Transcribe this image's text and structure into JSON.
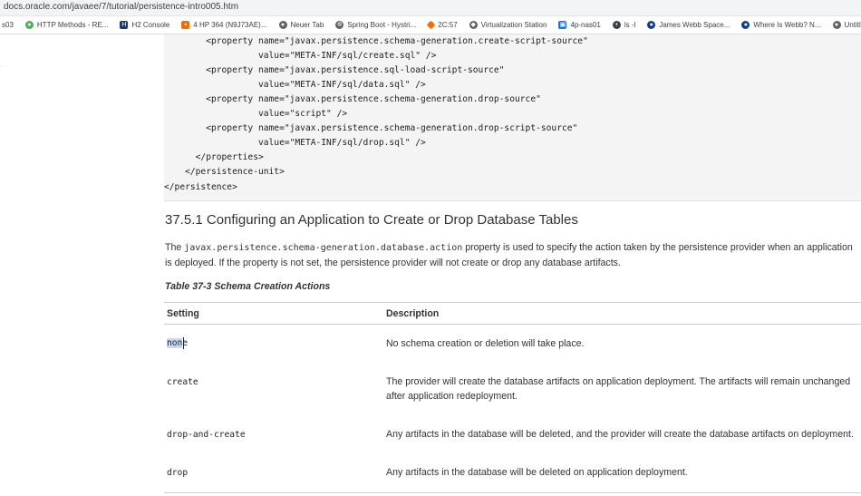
{
  "browser": {
    "url": "docs.oracle.com/javaee/7/tutorial/persistence-intro005.htm",
    "bookmarks": [
      {
        "label": "s03",
        "icon": "none",
        "color": "#ffffff"
      },
      {
        "label": "HTTP Methods - RE...",
        "icon": "globe-icon",
        "color": "#4caf50"
      },
      {
        "label": "H2 Console",
        "icon": "h2-icon",
        "color": "#1a3b6e"
      },
      {
        "label": "4 HP 364 (N9J73AE)...",
        "icon": "bookmark-icon",
        "color": "#e8710a"
      },
      {
        "label": "Neuer Tab",
        "icon": "globe-icon",
        "color": "#5f6368"
      },
      {
        "label": "Spring Boot - Hystri...",
        "icon": "gear-icon",
        "color": "#5f6368"
      },
      {
        "label": "2C:57",
        "icon": "diamond-icon",
        "color": "#e8710a"
      },
      {
        "label": "Virtualization Station",
        "icon": "vs-icon",
        "color": "#5f6368"
      },
      {
        "label": "4p-nas01",
        "icon": "nas-icon",
        "color": "#1a73e8"
      },
      {
        "label": "ls -l",
        "icon": "plus-icon",
        "color": "#5f6368"
      },
      {
        "label": "James Webb Space...",
        "icon": "nasa-icon",
        "color": "#0b3d91"
      },
      {
        "label": "Where Is Webb? N...",
        "icon": "nasa-icon",
        "color": "#0b3d91"
      },
      {
        "label": "Untitled",
        "icon": "globe-icon",
        "color": "#5f6368"
      }
    ]
  },
  "code": {
    "lines": [
      "        <property name=\"javax.persistence.schema-generation.create-script-source\"",
      "                  value=\"META-INF/sql/create.sql\" />",
      "        <property name=\"javax.persistence.sql-load-script-source\"",
      "                  value=\"META-INF/sql/data.sql\" />",
      "        <property name=\"javax.persistence.schema-generation.drop-source\"",
      "                  value=\"script\" />",
      "        <property name=\"javax.persistence.schema-generation.drop-script-source\"",
      "                  value=\"META-INF/sql/drop.sql\" />",
      "      </properties>",
      "    </persistence-unit>",
      "</persistence>"
    ]
  },
  "section": {
    "heading": "37.5.1 Configuring an Application to Create or Drop Database Tables",
    "para_before": "The ",
    "para_code": "javax.persistence.schema-generation.database.action",
    "para_after": " property is used to specify the action taken by the persistence provider when an application is deployed. If the property is not set, the persistence provider will not create or drop any database artifacts."
  },
  "table": {
    "caption": "Table 37-3 Schema Creation Actions",
    "headers": [
      "Setting",
      "Description"
    ],
    "rows": [
      {
        "setting_selected": "non",
        "setting_rest": "e",
        "description": "No schema creation or deletion will take place."
      },
      {
        "setting": "create",
        "description": "The provider will create the database artifacts on application deployment. The artifacts will remain unchanged after application redeployment."
      },
      {
        "setting": "drop-and-create",
        "description": "Any artifacts in the database will be deleted, and the provider will create the database artifacts on deployment."
      },
      {
        "setting": "drop",
        "description": "Any artifacts in the database will be deleted on application deployment."
      }
    ]
  }
}
